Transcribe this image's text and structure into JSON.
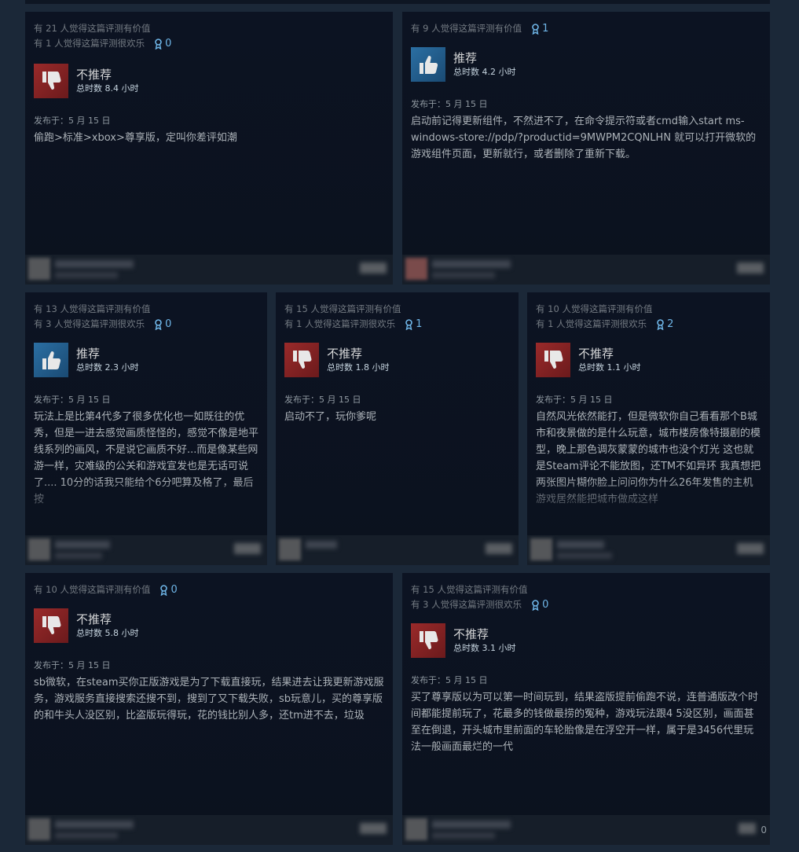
{
  "reviews": [
    {
      "helpful": "有 21 人觉得这篇评测有价值",
      "funny": "有 1 人觉得这篇评测很欢乐",
      "awards": "0",
      "verdict": "不推荐",
      "recommended": false,
      "hours": "总时数 8.4 小时",
      "posted": "发布于：5 月 15 日",
      "text": "偷跑>标准>xbox>尊享版，定叫你差评如潮"
    },
    {
      "helpful": "有 9 人觉得这篇评测有价值",
      "funny": "",
      "awards": "1",
      "verdict": "推荐",
      "recommended": true,
      "hours": "总时数 4.2 小时",
      "posted": "发布于：5 月 15 日",
      "text": "启动前记得更新组件，不然进不了，在命令提示符或者cmd输入start ms-windows-store://pdp/?productid=9MWPM2CQNLHN 就可以打开微软的游戏组件页面，更新就行，或者删除了重新下载。"
    },
    {
      "helpful": "有 13 人觉得这篇评测有价值",
      "funny": "有 3 人觉得这篇评测很欢乐",
      "awards": "0",
      "verdict": "推荐",
      "recommended": true,
      "hours": "总时数 2.3 小时",
      "posted": "发布于：5 月 15 日",
      "text": "玩法上是比第4代多了很多优化也一如既往的优秀，但是一进去感觉画质怪怪的，感觉不像是地平线系列的画风，不是说它画质不好...而是像某些网游一样，灾难级的公关和游戏宣发也是无话可说了.... 10分的话我只能给个6分吧算及格了，最后按"
    },
    {
      "helpful": "有 15 人觉得这篇评测有价值",
      "funny": "有 1 人觉得这篇评测很欢乐",
      "awards": "1",
      "verdict": "不推荐",
      "recommended": false,
      "hours": "总时数 1.8 小时",
      "posted": "发布于：5 月 15 日",
      "text": "启动不了，玩你爹呢"
    },
    {
      "helpful": "有 10 人觉得这篇评测有价值",
      "funny": "有 1 人觉得这篇评测很欢乐",
      "awards": "2",
      "verdict": "不推荐",
      "recommended": false,
      "hours": "总时数 1.1 小时",
      "posted": "发布于：5 月 15 日",
      "text": "自然风光依然能打，但是微软你自己看看那个B城市和夜景做的是什么玩意，城市楼房像特摄剧的模型，晚上那色调灰蒙蒙的城市也没个灯光 这也就是Steam评论不能放图，还TM不如异环 我真想把两张图片糊你脸上问问你为什么26年发售的主机游戏居然能把城市做成这样"
    },
    {
      "helpful": "有 10 人觉得这篇评测有价值",
      "funny": "",
      "awards": "0",
      "verdict": "不推荐",
      "recommended": false,
      "hours": "总时数 5.8 小时",
      "posted": "发布于：5 月 15 日",
      "text": "sb微软，在steam买你正版游戏是为了下载直接玩，结果进去让我更新游戏服务，游戏服务直接搜索还搜不到，搜到了又下载失败，sb玩意儿，买的尊享版的和牛头人没区别，比盗版玩得玩，花的钱比别人多，还tm进不去，垃圾"
    },
    {
      "helpful": "有 15 人觉得这篇评测有价值",
      "funny": "有 3 人觉得这篇评测很欢乐",
      "awards": "0",
      "verdict": "不推荐",
      "recommended": false,
      "hours": "总时数 3.1 小时",
      "posted": "发布于：5 月 15 日",
      "text": "买了尊享版以为可以第一时间玩到，结果盗版提前偷跑不说，连普通版改个时间都能提前玩了，花最多的钱做最捞的冤种，游戏玩法跟4 5没区别，画面甚至在倒退，开头城市里前面的车轮胎像是在浮空开一样，属于是3456代里玩法一般画面最烂的一代"
    }
  ],
  "footer_trailing_text": "0",
  "colors": {
    "background": "#1b2838",
    "card": "#0c1322",
    "award": "#6fb6e8",
    "thumb_down": "#9a2a2a",
    "thumb_up": "#2b6fa3"
  },
  "icons": {
    "thumb_down": "thumbs-down-icon",
    "thumb_up": "thumbs-up-icon",
    "award": "award-ribbon-icon"
  }
}
